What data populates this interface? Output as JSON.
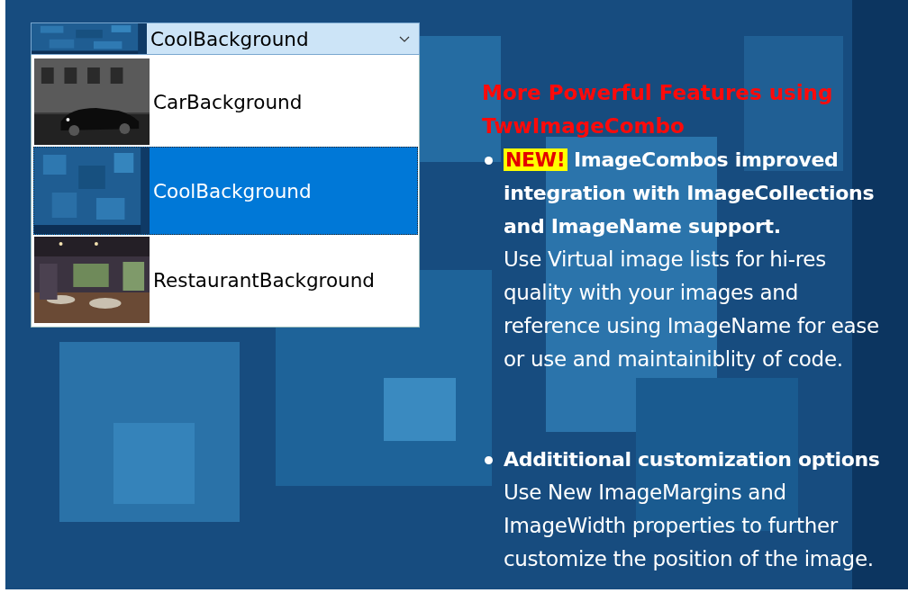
{
  "combo": {
    "value": "CoolBackground",
    "expanded": true,
    "items": [
      {
        "label": "CarBackground",
        "selected": false
      },
      {
        "label": "CoolBackground",
        "selected": true
      },
      {
        "label": "RestaurantBackground",
        "selected": false
      }
    ]
  },
  "features": {
    "heading": "More Powerful Features using TwwImageCombo",
    "bullets": [
      {
        "badge": "NEW!",
        "title": "ImageCombos improved integration with ImageCollections and ImageName support.",
        "body": "Use Virtual image lists for hi-res quality with your images and reference using ImageName for ease or use and maintainiblity of code."
      },
      {
        "title": "Addititional customization options",
        "body": "Use New ImageMargins and ImageWidth properties to further customize the position of the image."
      }
    ]
  }
}
